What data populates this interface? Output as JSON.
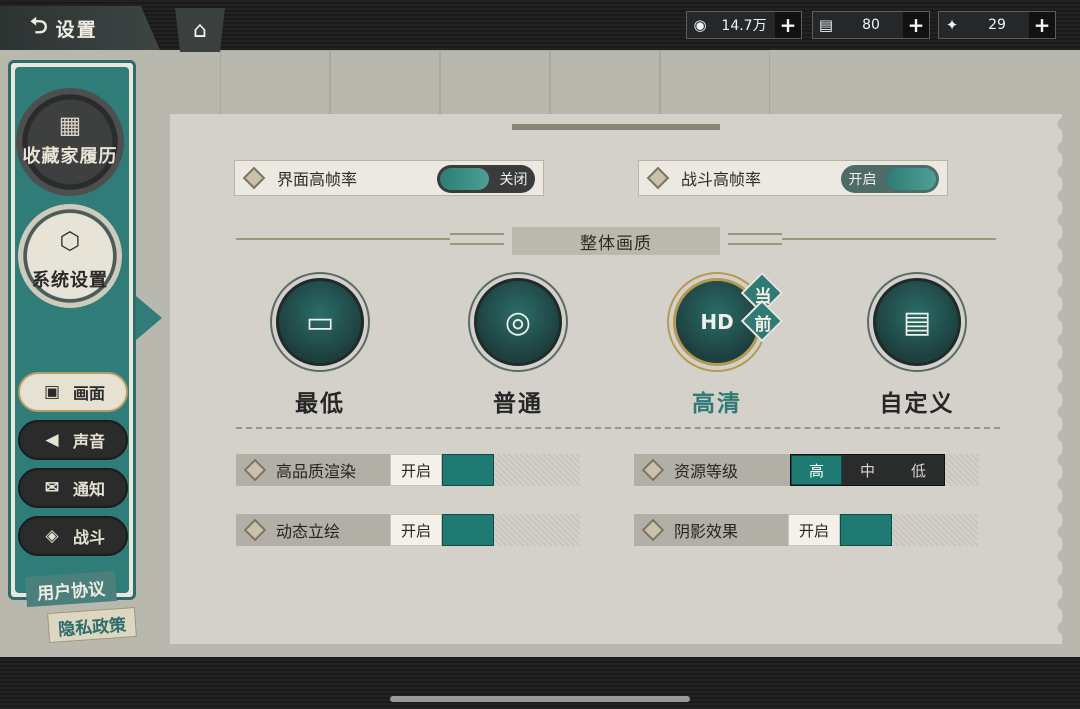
{
  "header": {
    "back_label": "设置",
    "back_glyph": "⮌",
    "home_glyph": "⌂",
    "resources": [
      {
        "icon": "◉",
        "value": "14.7万",
        "plus": "+"
      },
      {
        "icon": "▤",
        "value": "80",
        "plus": "+"
      },
      {
        "icon": "✦",
        "value": "29",
        "plus": "+"
      }
    ]
  },
  "sidebar": {
    "collection_label": "收藏家履历",
    "collection_icon": "▦",
    "system_label": "系统设置",
    "system_icon": "⬡",
    "items": [
      {
        "label": "画面",
        "icon": "▣"
      },
      {
        "label": "声音",
        "icon": "◀"
      },
      {
        "label": "通知",
        "icon": "✉"
      },
      {
        "label": "战斗",
        "icon": "◈"
      }
    ],
    "user_agreement": "用户协议",
    "privacy_policy": "隐私政策"
  },
  "toggles": [
    {
      "label": "界面高帧率",
      "state": "关闭"
    },
    {
      "label": "战斗高帧率",
      "state": "开启"
    }
  ],
  "section_title": "整体画质",
  "quality": [
    {
      "label": "最低",
      "icon": "▭"
    },
    {
      "label": "普通",
      "icon": "◎"
    },
    {
      "label": "高清",
      "icon": "HD"
    },
    {
      "label": "自定义",
      "icon": "▤"
    }
  ],
  "current_badge": [
    "当",
    "前"
  ],
  "options": {
    "hq_render": {
      "label": "高品质渲染",
      "value": "开启"
    },
    "dynamic_art": {
      "label": "动态立绘",
      "value": "开启"
    },
    "resource_level": {
      "label": "资源等级",
      "levels": [
        "高",
        "中",
        "低"
      ],
      "selected": "高"
    },
    "shadow": {
      "label": "阴影效果",
      "value": "开启"
    }
  },
  "colors": {
    "accent_teal": "#2f7a75",
    "panel_bg": "#d3d1ca",
    "dark": "#2a2c2c"
  }
}
